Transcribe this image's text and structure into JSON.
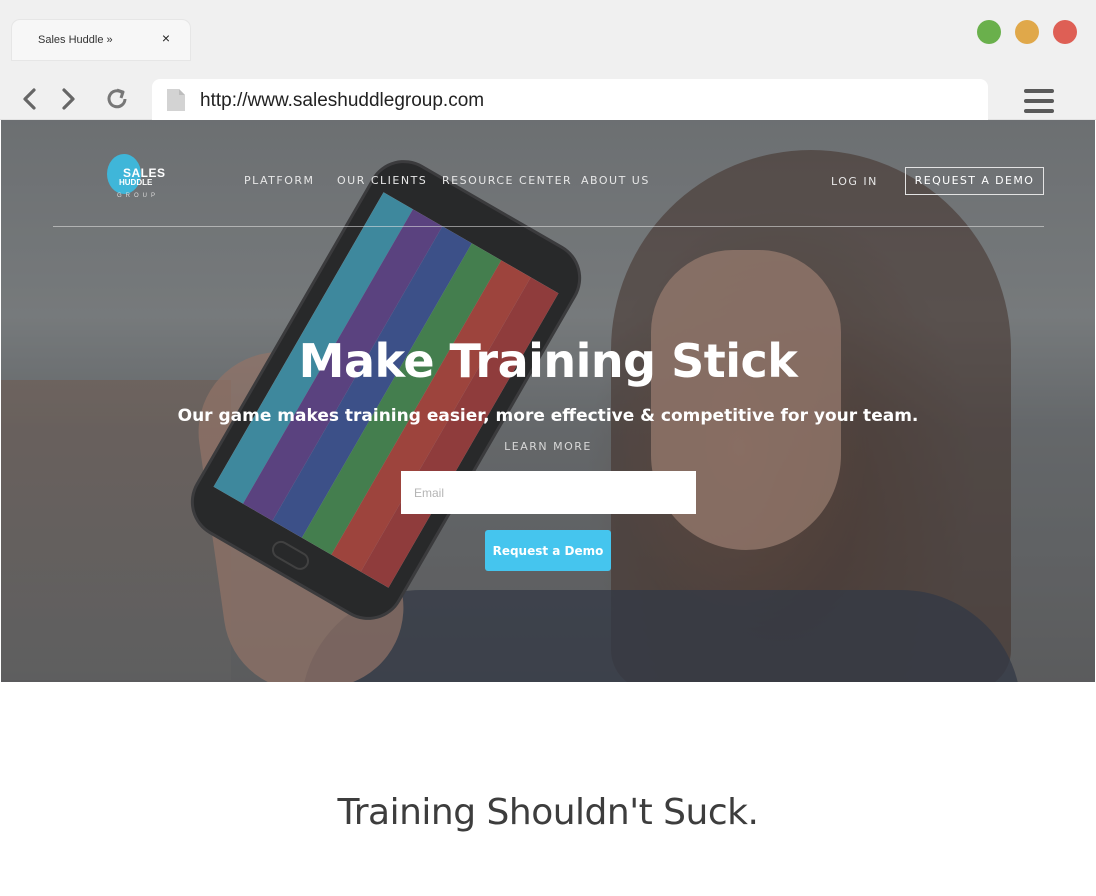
{
  "browser": {
    "tab_title": "Sales Huddle »",
    "tab_close": "×",
    "url": "http://www.saleshuddlegroup.com",
    "traffic_lights": {
      "green": "#6ab04c",
      "yellow": "#e0a84a",
      "red": "#de5f55"
    },
    "icons": [
      "chevron-left-icon",
      "chevron-right-icon",
      "reload-icon",
      "page-icon",
      "hamburger-menu-icon",
      "close-icon"
    ]
  },
  "site": {
    "logo": {
      "line1": "SALES",
      "line2": "HUDDLE",
      "line3": "GROUP"
    },
    "nav": {
      "platform": "PLATFORM",
      "clients": "OUR CLIENTS",
      "resource": "RESOURCE CENTER",
      "about": "ABOUT US",
      "login": "LOG IN",
      "demo": "REQUEST A DEMO"
    },
    "hero": {
      "title": "Make Training Stick",
      "subtitle": "Our game makes training easier, more effective & competitive for your team.",
      "learn_more": "LEARN MORE",
      "email_placeholder": "Email",
      "cta": "Request a Demo"
    },
    "section_title": "Training Shouldn't Suck.",
    "colors": {
      "accent": "#45c5ee",
      "logo": "#3fb6d9"
    }
  }
}
